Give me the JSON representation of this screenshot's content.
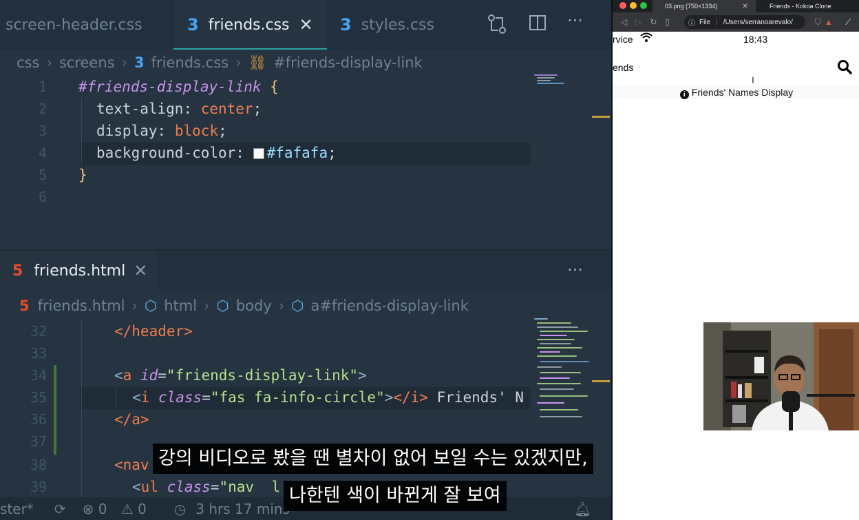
{
  "editor": {
    "tabs": [
      {
        "label": "screen-header.css",
        "icon": "none",
        "active": false
      },
      {
        "label": "friends.css",
        "icon": "css3-icon",
        "active": true
      },
      {
        "label": "styles.css",
        "icon": "css3-icon",
        "active": false
      }
    ],
    "top_breadcrumb": [
      "css",
      "screens",
      "friends.css",
      "#friends-display-link"
    ],
    "css_lines": [
      {
        "n": "1",
        "selector": "#friends-display-link",
        "brace": "{"
      },
      {
        "n": "2",
        "prop": "text-align",
        "value": "center"
      },
      {
        "n": "3",
        "prop": "display",
        "value": "block"
      },
      {
        "n": "4",
        "prop": "background-color",
        "value": "#fafafa"
      },
      {
        "n": "5",
        "brace": "}"
      },
      {
        "n": "6"
      }
    ],
    "bottom_tab": {
      "label": "friends.html"
    },
    "bottom_breadcrumb": [
      "friends.html",
      "html",
      "body",
      "a#friends-display-link"
    ],
    "html_lines": [
      {
        "n": "32",
        "text": "</header>"
      },
      {
        "n": "33",
        "text": ""
      },
      {
        "n": "34",
        "tag": "a",
        "attr": "id",
        "value": "\"friends-display-link\""
      },
      {
        "n": "35",
        "tag": "i",
        "attr": "class",
        "value": "\"fas fa-info-circle\"",
        "close": "</i>",
        "after": " Friends' N"
      },
      {
        "n": "36",
        "text": "</a>"
      },
      {
        "n": "37",
        "text": ""
      },
      {
        "n": "38",
        "text": "<nav"
      },
      {
        "n": "39",
        "tag": "ul",
        "attr": "class",
        "value": "\"nav  l"
      }
    ],
    "status": {
      "branch": "ster*",
      "errors": "0",
      "warnings": "0",
      "time": "3 hrs 17 mins"
    }
  },
  "browser": {
    "tabs": [
      {
        "label": "03.png (750×1334)",
        "active": true
      },
      {
        "label": "Friends - Kokoa Clone",
        "active": false
      }
    ],
    "address": {
      "scheme": "File",
      "path": "/Users/serranoarevalo/"
    },
    "phone_status": {
      "left": "rvice",
      "time": "18:43"
    },
    "app_header_title": "ends",
    "display_link_text": "Friends' Names Display"
  },
  "subtitles": [
    "강의 비디오로 봤을 땐 별차이 없어 보일 수는 있겠지만,",
    "나한텐 색이 바뀐게 잘 보여"
  ]
}
